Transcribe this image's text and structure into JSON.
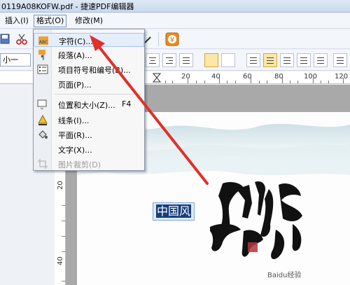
{
  "window": {
    "title": "0119A08KOFW.pdf - 捷速PDF编辑器"
  },
  "menubar": {
    "items": [
      {
        "label": "插入(I)"
      },
      {
        "label": "格式(O)"
      },
      {
        "label": "修改(M)"
      }
    ]
  },
  "format_menu": {
    "items": [
      {
        "label": "字符(C)...",
        "shortcut": "",
        "icon": "character-icon"
      },
      {
        "label": "段落(A)...",
        "shortcut": "",
        "icon": "paragraph-icon"
      },
      {
        "label": "项目符号和编号(B)...",
        "shortcut": "",
        "icon": "bullets-icon"
      },
      {
        "label": "页面(P)...",
        "shortcut": "",
        "icon": ""
      },
      {
        "label": "位置和大小(Z)...",
        "shortcut": "F4",
        "icon": "position-size-icon"
      },
      {
        "label": "线条(I)...",
        "shortcut": "",
        "icon": "line-icon"
      },
      {
        "label": "平面(R)...",
        "shortcut": "",
        "icon": "fill-icon"
      },
      {
        "label": "文字(X)...",
        "shortcut": "",
        "icon": ""
      },
      {
        "label": "图片裁剪(D)",
        "shortcut": "",
        "icon": "crop-icon",
        "disabled": true
      }
    ]
  },
  "toolbar2": {
    "font_size": "小一"
  },
  "ruler": {
    "marks": [
      "20",
      "40",
      "60",
      "80",
      "100",
      "120"
    ]
  },
  "vruler": {
    "marks": [
      "20",
      "40"
    ]
  },
  "document": {
    "selected_text": "中国风"
  },
  "colors": {
    "accent_arrow": "#e0302a",
    "selection": "#163e7a"
  }
}
